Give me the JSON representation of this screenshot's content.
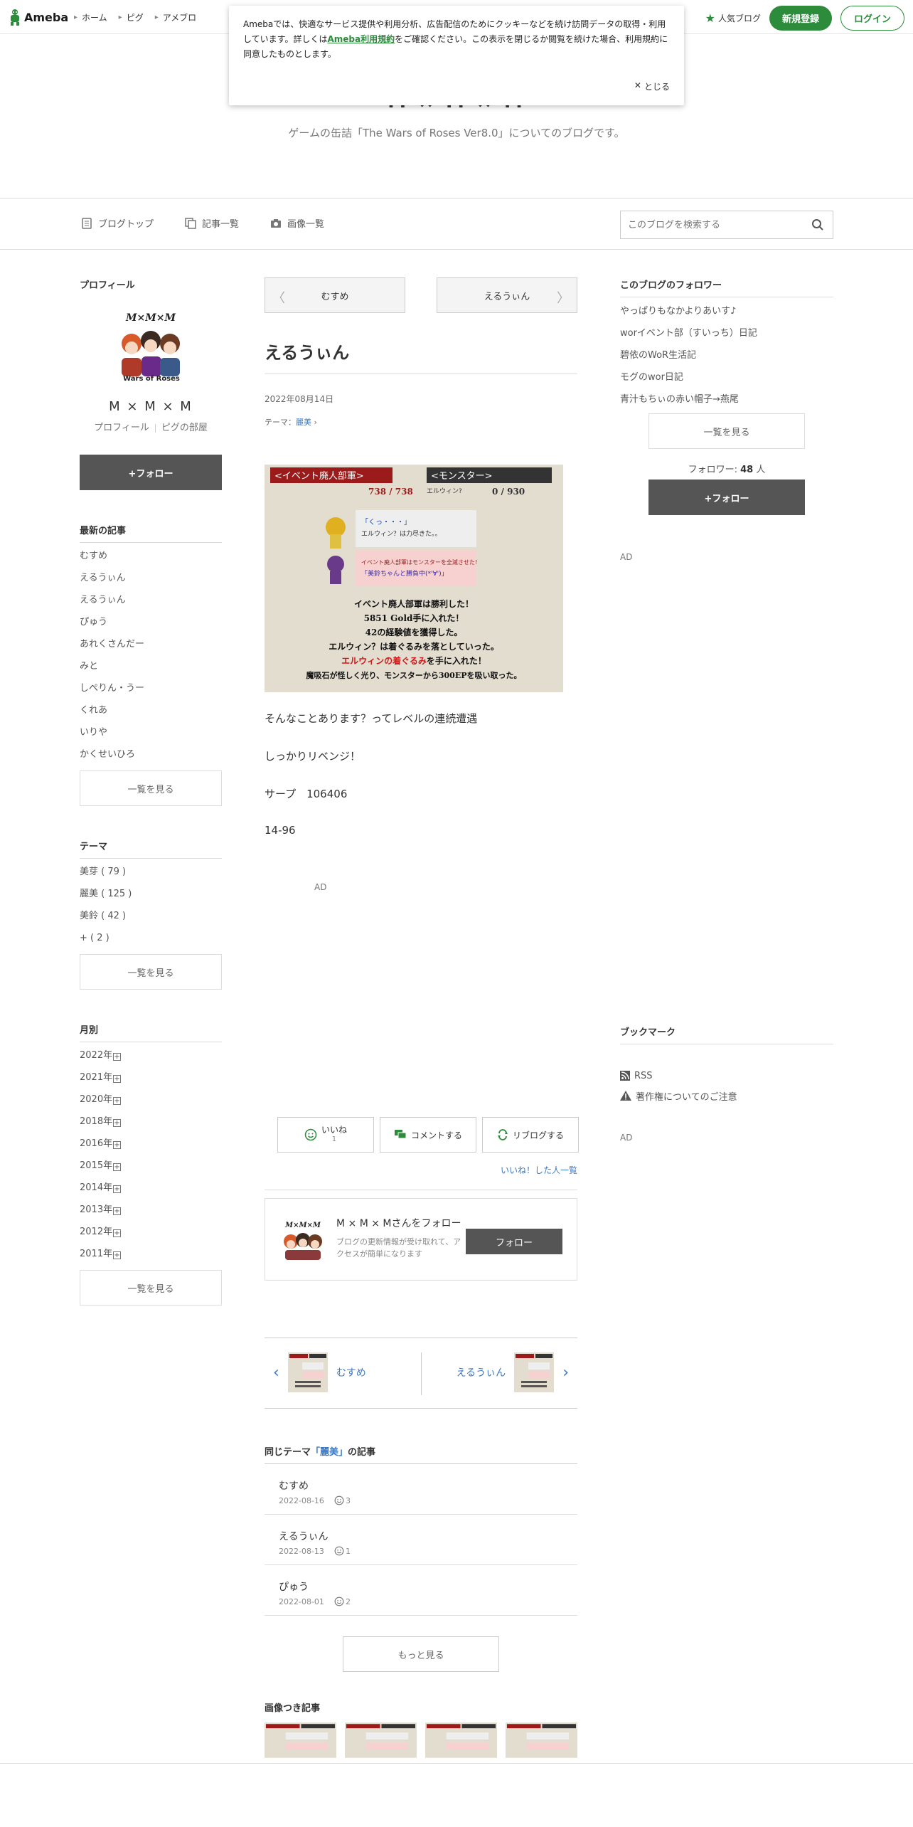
{
  "topnav": {
    "logo_text": "Ameba",
    "items": [
      "ホーム",
      "ピグ",
      "アメブロ"
    ],
    "popular_label": "人気ブログ",
    "register_label": "新規登録",
    "login_label": "ログイン"
  },
  "cookie": {
    "text_before": "Amebaでは、快適なサービス提供や利用分析、広告配信のためにクッキーなどを続け訪問データの取得・利用しています。詳しくは",
    "terms_link": "Ameba利用規約",
    "text_after": "をご確認ください。この表示を閉じるか閲覧を続けた場合、利用規約に同意したものとします。",
    "close_label": "とじる"
  },
  "blog": {
    "title": "M × M × M",
    "description": "ゲームの缶詰「The Wars of Roses Ver8.0」についてのブログです。"
  },
  "blognav": {
    "top": "ブログトップ",
    "list": "記事一覧",
    "images": "画像一覧",
    "search_placeholder": "このブログを検索する"
  },
  "profile": {
    "section_title": "プロフィール",
    "name": "M × M × M",
    "link_profile": "プロフィール",
    "link_room": "ピグの部屋",
    "follow_label": "+フォロー"
  },
  "latest": {
    "title": "最新の記事",
    "items": [
      "むすめ",
      "えるうぃん",
      "えるうぃん",
      "ぴゅう",
      "あれくさんだー",
      "みと",
      "しぺりん・うー",
      "くれあ",
      "いりや",
      "かくせいひろ"
    ],
    "more": "一覧を見る"
  },
  "themes": {
    "title": "テーマ",
    "items": [
      "美芽 ( 79 )",
      "麗美 ( 125 )",
      "美鈴 ( 42 )",
      "+ ( 2 )"
    ],
    "more": "一覧を見る"
  },
  "monthly": {
    "title": "月別",
    "items": [
      "2022年",
      "2021年",
      "2020年",
      "2018年",
      "2016年",
      "2015年",
      "2014年",
      "2013年",
      "2012年",
      "2011年"
    ],
    "more": "一覧を見る"
  },
  "entry": {
    "prev_label": "むすめ",
    "next_label": "えるうぃん",
    "title": "えるうぃん",
    "date": "2022年08月14日",
    "theme_prefix": "テーマ：",
    "theme": "麗美",
    "paragraphs": [
      "そんなことあります？ってレベルの連続遭遇",
      "しっかりリベンジ！",
      "サープ　106406",
      "14-96"
    ],
    "ad_label": "AD",
    "like_label": "いいね",
    "like_count": "1",
    "comment_label": "コメントする",
    "reblog_label": "リブログする",
    "like_users": "いいね！した人一覧"
  },
  "game_screenshot": {
    "header_left": "<イベント廃人部軍>",
    "header_right": "<モンスター>",
    "hp_left": "738 / 738",
    "enemy_name": "エルウィン?",
    "hp_right": "0 / 930",
    "bubble1_line1": "「くっ・・・」",
    "bubble1_line2": "エルウィン？は力尽きた。。",
    "bubble2_line1": "イベント廃人部軍はモンスターを全滅させた！",
    "bubble2_line2": "「美鈴ちゃんと勝負中(*'∀')」",
    "result1": "イベント廃人部軍は勝利した！",
    "result2": "5851 Gold手に入れた！",
    "result3": "42の経験値を獲得した。",
    "result4": "エルウィン？は着ぐるみを落としていった。",
    "result5_red": "エルウィンの着ぐるみ",
    "result5_rest": "を手に入れた！",
    "result6": "魔吸石が怪しく光り、モンスターから300EPを吸い取った。"
  },
  "follow_card": {
    "name": "M × M × Mさんをフォロー",
    "desc": "ブログの更新情報が受け取れて、アクセスが簡単になります",
    "button": "フォロー"
  },
  "article_nav": {
    "prev": "むすめ",
    "next": "えるうぃん"
  },
  "same_theme": {
    "title_pre": "同じテーマ",
    "theme": "「麗美」",
    "title_post": "の記事",
    "items": [
      {
        "title": "むすめ",
        "date": "2022-08-16",
        "count": "3"
      },
      {
        "title": "えるうぃん",
        "date": "2022-08-13",
        "count": "1"
      },
      {
        "title": "ぴゅう",
        "date": "2022-08-01",
        "count": "2"
      }
    ],
    "more": "もっと見る"
  },
  "image_articles": {
    "title": "画像つき記事"
  },
  "followers": {
    "title": "このブログのフォロワー",
    "items": [
      "やっぱりもなかよりあいす♪",
      "worイベント部（すいっち）日記",
      "碧依のWoR生活記",
      "モグのwor日記",
      "青汁もちぃの赤い帽子→燕尾"
    ],
    "more": "一覧を見る",
    "count_label": "フォロワー:",
    "count": "48",
    "count_unit": "人",
    "follow_label": "+フォロー",
    "ad_label": "AD"
  },
  "bookmark": {
    "title": "ブックマーク",
    "rss": "RSS",
    "copyright": "著作権についてのご注意",
    "ad_label": "AD"
  },
  "colors": {
    "ameba_green": "#2d8c3c",
    "link_blue": "#3a79c6",
    "dark_button": "#555555"
  }
}
